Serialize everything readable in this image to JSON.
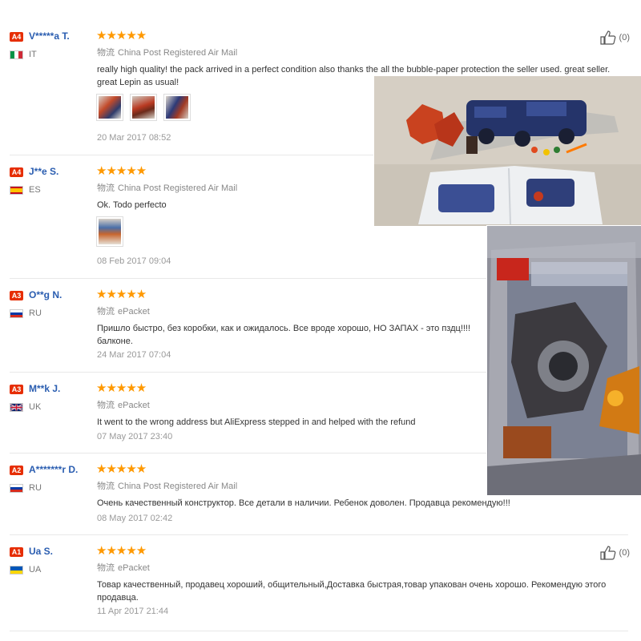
{
  "common": {
    "shipping_cn": "物流",
    "stars": "★★★★★"
  },
  "reviews": [
    {
      "badge": "A4",
      "name": "V*****a T.",
      "country": "IT",
      "shipping": "China Post Registered Air Mail",
      "text": "really high quality! the pack arrived in a perfect condition also thanks the all the bubble-paper protection the seller used. great seller. great Lepin as usual!",
      "date": "20 Mar 2017 08:52",
      "helpful": "(0)"
    },
    {
      "badge": "A4",
      "name": "J**e S.",
      "country": "ES",
      "shipping": "China Post Registered Air Mail",
      "text": "Ok. Todo perfecto",
      "date": "08 Feb 2017 09:04"
    },
    {
      "badge": "A3",
      "name": "O**g N.",
      "country": "RU",
      "shipping": "ePacket",
      "text": "Пришло быстро, без коробки, как и ожидалось. Все вроде хорошо, НО ЗАПАХ - это пздц!!!! балконе.",
      "date": "24 Mar 2017 07:04"
    },
    {
      "badge": "A3",
      "name": "M**k J.",
      "country": "UK",
      "shipping": "ePacket",
      "text": "It went to the wrong address but AliExpress stepped in and helped with the refund",
      "date": "07 May 2017 23:40"
    },
    {
      "badge": "A2",
      "name": "A*******r D.",
      "country": "RU",
      "shipping": "China Post Registered Air Mail",
      "text": "Очень качественный конструктор. Все детали в наличии. Ребенок доволен. Продавца рекомендую!!!",
      "date": "08 May 2017 02:42"
    },
    {
      "badge": "A1",
      "name": "Ua S.",
      "country": "UA",
      "shipping": "ePacket",
      "text": "Товар качественный, продавец хороший, общительный,Доставка быстрая,товар упакован очень хорошо. Рекомендую этого продавца.",
      "date": "11 Apr 2017 21:44",
      "helpful": "(0)"
    }
  ]
}
